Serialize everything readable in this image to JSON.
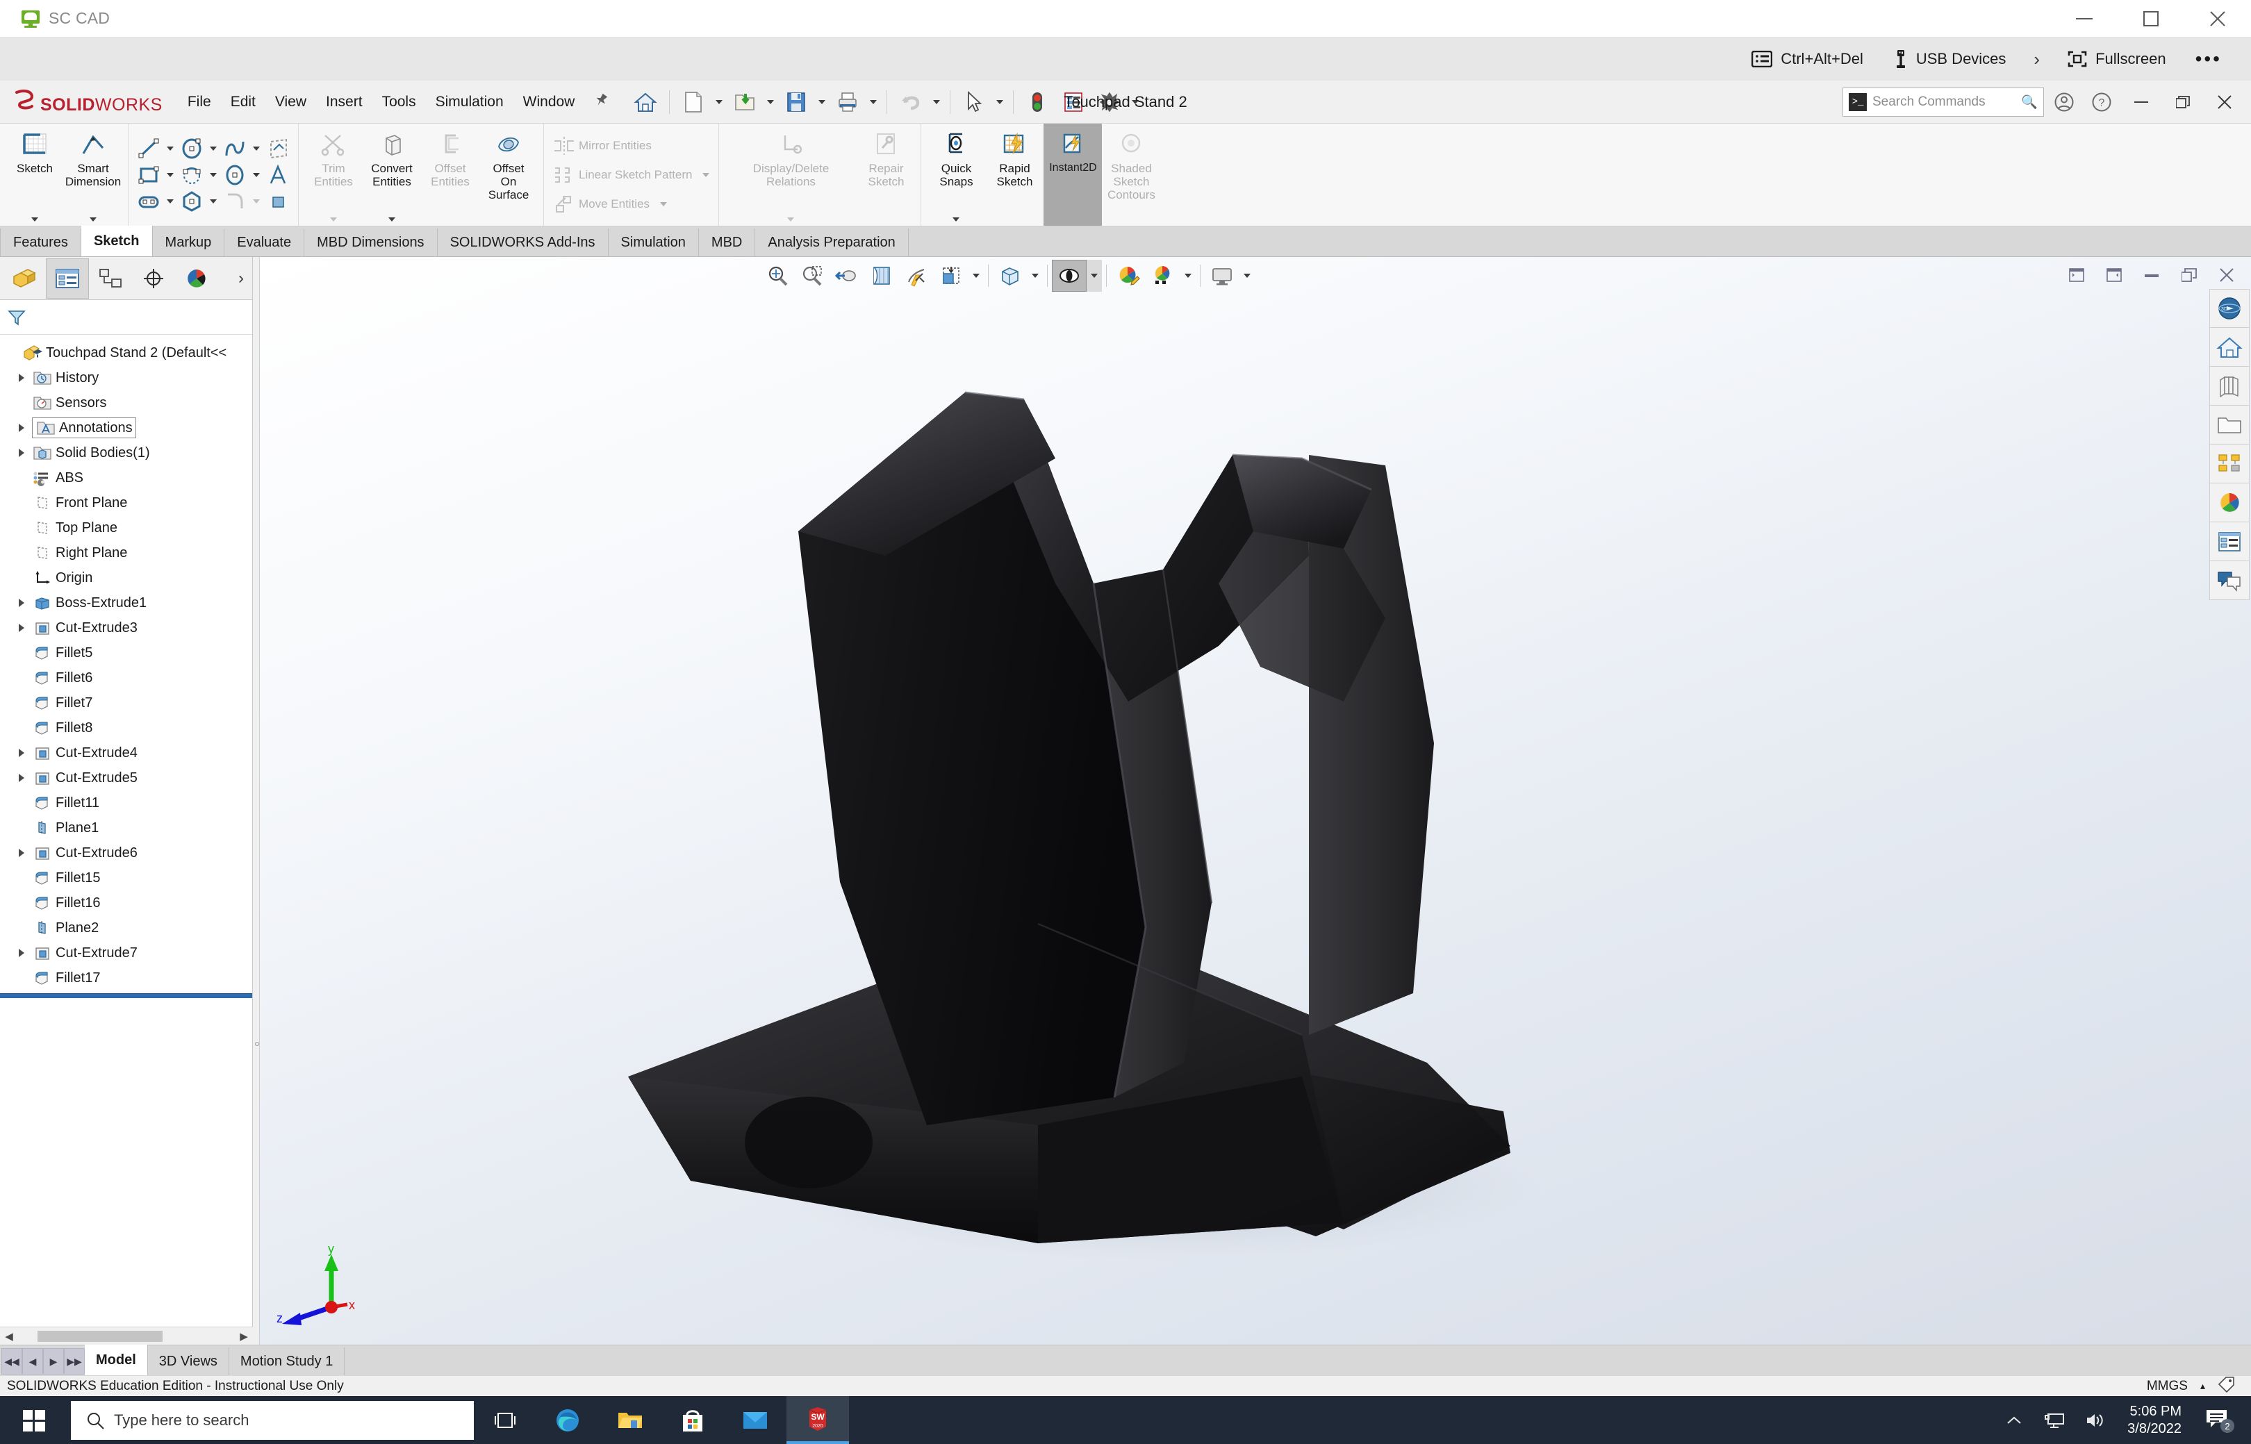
{
  "viewer": {
    "app_title": "SC CAD",
    "window_buttons": [
      "minimize",
      "maximize",
      "close"
    ],
    "toolbar": [
      {
        "label": "Ctrl+Alt+Del",
        "icon": "keyboard-icon"
      },
      {
        "label": "USB Devices",
        "icon": "usb-icon"
      }
    ],
    "expand_label": "›",
    "fullscreen_label": "Fullscreen",
    "more_label": "•••"
  },
  "solidworks": {
    "brand_ds": "ẞ",
    "brand_solid": "SOLID",
    "brand_works": "WORKS",
    "document_title": "Touchpad Stand 2",
    "menus": [
      "File",
      "Edit",
      "View",
      "Insert",
      "Tools",
      "Simulation",
      "Window"
    ],
    "pin_icon": "pin-icon",
    "quick_tools": [
      {
        "name": "home-icon",
        "caret": false
      },
      {
        "name": "new-document-icon",
        "caret": true
      },
      {
        "name": "open-folder-icon",
        "caret": true
      },
      {
        "name": "save-icon",
        "caret": true
      },
      {
        "name": "print-icon",
        "caret": true
      },
      {
        "name": "undo-icon",
        "caret": true
      },
      {
        "name": "select-cursor-icon",
        "caret": true
      },
      {
        "name": "rebuild-traffic-light-icon",
        "caret": false
      },
      {
        "name": "options-list-icon",
        "caret": false
      },
      {
        "name": "settings-gear-icon",
        "caret": true
      }
    ],
    "search": {
      "placeholder": "Search Commands",
      "prompt_icon": "console-icon",
      "mag_icon": "search-icon"
    },
    "header_right_icons": [
      "account-icon",
      "help-icon"
    ],
    "window_controls": [
      "minimize",
      "maximize",
      "close"
    ],
    "ribbon": {
      "groups": [
        {
          "kind": "big",
          "items": [
            {
              "label": "Sketch",
              "icon": "sketch-grid-icon",
              "caret": true,
              "disabled": false,
              "active": false
            },
            {
              "label": "Smart\nDimension",
              "icon": "smart-dimension-icon",
              "caret": true,
              "disabled": false,
              "active": false
            }
          ]
        },
        {
          "kind": "grid",
          "rows": [
            [
              {
                "icon": "line-icon",
                "caret": true
              },
              {
                "icon": "circle-icon",
                "caret": true
              },
              {
                "icon": "spline-icon",
                "caret": true
              },
              {
                "icon": "sketch-plane-icon",
                "caret": false
              }
            ],
            [
              {
                "icon": "rectangle-icon",
                "caret": true
              },
              {
                "icon": "arc-icon",
                "caret": true
              },
              {
                "icon": "ellipse-icon",
                "caret": true
              },
              {
                "icon": "text-a-icon",
                "caret": false
              }
            ],
            [
              {
                "icon": "slot-icon",
                "caret": true
              },
              {
                "icon": "polygon-icon",
                "caret": true
              },
              {
                "icon": "fillet-arc-icon",
                "caret": true
              },
              {
                "icon": "shaded-square-icon",
                "caret": false
              }
            ]
          ]
        },
        {
          "kind": "big",
          "items": [
            {
              "label": "Trim\nEntities",
              "icon": "trim-scissors-icon",
              "caret": true,
              "disabled": true,
              "active": false
            },
            {
              "label": "Convert\nEntities",
              "icon": "convert-entities-icon",
              "caret": true,
              "disabled": false,
              "active": false
            },
            {
              "label": "Offset\nEntities",
              "icon": "offset-entities-icon",
              "caret": false,
              "disabled": true,
              "active": false
            },
            {
              "label": "Offset\nOn\nSurface",
              "icon": "offset-on-surface-icon",
              "caret": false,
              "disabled": false,
              "active": false
            }
          ]
        },
        {
          "kind": "list",
          "rows": [
            {
              "label": "Mirror Entities",
              "icon": "mirror-entities-icon",
              "caret": false,
              "disabled": true
            },
            {
              "label": "Linear Sketch Pattern",
              "icon": "linear-sketch-pattern-icon",
              "caret": true,
              "disabled": true
            },
            {
              "label": "Move Entities",
              "icon": "move-entities-icon",
              "caret": true,
              "disabled": true
            }
          ]
        },
        {
          "kind": "big",
          "items": [
            {
              "label": "Display/Delete\nRelations",
              "icon": "display-delete-relations-icon",
              "caret": true,
              "disabled": true,
              "active": false
            },
            {
              "label": "Repair\nSketch",
              "icon": "repair-sketch-icon",
              "caret": false,
              "disabled": true,
              "active": false
            }
          ]
        },
        {
          "kind": "big",
          "items": [
            {
              "label": "Quick\nSnaps",
              "icon": "quick-snaps-icon",
              "caret": true,
              "disabled": false,
              "active": false
            },
            {
              "label": "Rapid\nSketch",
              "icon": "rapid-sketch-icon",
              "caret": false,
              "disabled": false,
              "active": false
            },
            {
              "label": "Instant2D",
              "icon": "instant2d-icon",
              "caret": false,
              "disabled": false,
              "active": true
            },
            {
              "label": "Shaded\nSketch\nContours",
              "icon": "shaded-sketch-contours-icon",
              "caret": false,
              "disabled": true,
              "active": false
            }
          ]
        }
      ]
    },
    "command_tabs": [
      {
        "label": "Features",
        "active": false
      },
      {
        "label": "Sketch",
        "active": true
      },
      {
        "label": "Markup",
        "active": false
      },
      {
        "label": "Evaluate",
        "active": false
      },
      {
        "label": "MBD Dimensions",
        "active": false
      },
      {
        "label": "SOLIDWORKS Add-Ins",
        "active": false
      },
      {
        "label": "Simulation",
        "active": false
      },
      {
        "label": "MBD",
        "active": false
      },
      {
        "label": "Analysis Preparation",
        "active": false
      }
    ],
    "feature_manager": {
      "tabs": [
        {
          "name": "feature-manager-tab",
          "selected": false
        },
        {
          "name": "property-manager-tab",
          "selected": true
        },
        {
          "name": "configuration-manager-tab",
          "selected": false
        },
        {
          "name": "dimxpert-manager-tab",
          "selected": false
        },
        {
          "name": "display-manager-tab",
          "selected": false
        }
      ],
      "more_tabs_label": "›",
      "filter_icon": "filter-funnel-icon",
      "tree": [
        {
          "label": "Touchpad Stand 2  (Default<<",
          "icon": "part-grad-icon",
          "expandable": false,
          "indent": 0,
          "root": true
        },
        {
          "label": "History",
          "icon": "history-folder-icon",
          "expandable": true,
          "indent": 1
        },
        {
          "label": "Sensors",
          "icon": "sensors-folder-icon",
          "expandable": false,
          "indent": 1
        },
        {
          "label": "Annotations",
          "icon": "annotations-folder-icon",
          "expandable": true,
          "indent": 1,
          "boxed": true
        },
        {
          "label": "Solid Bodies(1)",
          "icon": "solid-bodies-folder-icon",
          "expandable": true,
          "indent": 1
        },
        {
          "label": "ABS",
          "icon": "material-icon",
          "expandable": false,
          "indent": 1
        },
        {
          "label": "Front Plane",
          "icon": "plane-icon",
          "expandable": false,
          "indent": 1
        },
        {
          "label": "Top Plane",
          "icon": "plane-icon",
          "expandable": false,
          "indent": 1
        },
        {
          "label": "Right Plane",
          "icon": "plane-icon",
          "expandable": false,
          "indent": 1
        },
        {
          "label": "Origin",
          "icon": "origin-icon",
          "expandable": false,
          "indent": 1
        },
        {
          "label": "Boss-Extrude1",
          "icon": "boss-extrude-icon",
          "expandable": true,
          "indent": 1
        },
        {
          "label": "Cut-Extrude3",
          "icon": "cut-extrude-icon",
          "expandable": true,
          "indent": 1
        },
        {
          "label": "Fillet5",
          "icon": "fillet-icon",
          "expandable": false,
          "indent": 1
        },
        {
          "label": "Fillet6",
          "icon": "fillet-icon",
          "expandable": false,
          "indent": 1
        },
        {
          "label": "Fillet7",
          "icon": "fillet-icon",
          "expandable": false,
          "indent": 1
        },
        {
          "label": "Fillet8",
          "icon": "fillet-icon",
          "expandable": false,
          "indent": 1
        },
        {
          "label": "Cut-Extrude4",
          "icon": "cut-extrude-icon",
          "expandable": true,
          "indent": 1
        },
        {
          "label": "Cut-Extrude5",
          "icon": "cut-extrude-icon",
          "expandable": true,
          "indent": 1
        },
        {
          "label": "Fillet11",
          "icon": "fillet-icon",
          "expandable": false,
          "indent": 1
        },
        {
          "label": "Plane1",
          "icon": "plane-blue-icon",
          "expandable": false,
          "indent": 1
        },
        {
          "label": "Cut-Extrude6",
          "icon": "cut-extrude-icon",
          "expandable": true,
          "indent": 1
        },
        {
          "label": "Fillet15",
          "icon": "fillet-icon",
          "expandable": false,
          "indent": 1
        },
        {
          "label": "Fillet16",
          "icon": "fillet-icon",
          "expandable": false,
          "indent": 1
        },
        {
          "label": "Plane2",
          "icon": "plane-blue-icon",
          "expandable": false,
          "indent": 1
        },
        {
          "label": "Cut-Extrude7",
          "icon": "cut-extrude-icon",
          "expandable": true,
          "indent": 1
        },
        {
          "label": "Fillet17",
          "icon": "fillet-icon",
          "expandable": false,
          "indent": 1
        }
      ]
    },
    "heads_up_toolbar": [
      {
        "name": "zoom-to-fit-icon",
        "caret": false,
        "on": false
      },
      {
        "name": "zoom-to-area-icon",
        "caret": false,
        "on": false
      },
      {
        "name": "previous-view-icon",
        "caret": false,
        "on": false
      },
      {
        "name": "section-view-icon",
        "caret": false,
        "on": false
      },
      {
        "name": "view-orientation-icon",
        "caret": false,
        "on": false
      },
      {
        "name": "view-orientation-cube-icon",
        "caret": true,
        "on": false
      },
      {
        "name": "display-style-icon",
        "caret": true,
        "on": false
      },
      {
        "name": "hide-show-items-icon",
        "caret": true,
        "on": true
      },
      {
        "name": "edit-appearance-icon",
        "caret": false,
        "on": false
      },
      {
        "name": "apply-scene-icon",
        "caret": true,
        "on": false
      },
      {
        "name": "view-settings-icon",
        "caret": true,
        "on": false
      }
    ],
    "graphics_window_controls": [
      "restore-left",
      "restore-right",
      "minimize",
      "restore",
      "close"
    ],
    "task_pane": [
      "3d-sphere-icon",
      "sw-resources-home-icon",
      "design-library-icon",
      "file-explorer-folder-icon",
      "view-palette-icon",
      "appearances-scenes-icon",
      "custom-properties-icon",
      "solidworks-forum-icon"
    ],
    "triad": {
      "x_label": "x",
      "y_label": "y",
      "z_label": "z"
    },
    "bottom_tabs": [
      {
        "label": "Model",
        "active": true
      },
      {
        "label": "3D Views",
        "active": false
      },
      {
        "label": "Motion Study 1",
        "active": false
      }
    ],
    "status_bar": {
      "message": "SOLIDWORKS Education Edition - Instructional Use Only",
      "units": "MMGS",
      "units_caret": "▴",
      "tag_icon": "tag-icon"
    }
  },
  "taskbar": {
    "start_icon": "windows-start-icon",
    "search_placeholder": "Type here to search",
    "search_icon": "search-icon",
    "items": [
      {
        "name": "task-view-icon",
        "active": false
      },
      {
        "name": "microsoft-edge-icon",
        "active": false
      },
      {
        "name": "file-explorer-icon",
        "active": false
      },
      {
        "name": "microsoft-store-icon",
        "active": false
      },
      {
        "name": "mail-icon",
        "active": false
      },
      {
        "name": "solidworks-2020-icon",
        "active": true,
        "badge": "2020"
      }
    ],
    "tray": [
      {
        "name": "show-hidden-icons-chevron"
      },
      {
        "name": "network-icon"
      },
      {
        "name": "volume-icon"
      }
    ],
    "clock_time": "5:06 PM",
    "clock_date": "3/8/2022",
    "notification_count": "2",
    "notification_icon": "notifications-icon"
  },
  "colors": {
    "sw_red": "#b8202e",
    "accent_blue": "#2b6cb0",
    "taskbar_bg": "#1f2937",
    "model_black": "#121212",
    "ribbon_bg": "#f7f7f7"
  }
}
